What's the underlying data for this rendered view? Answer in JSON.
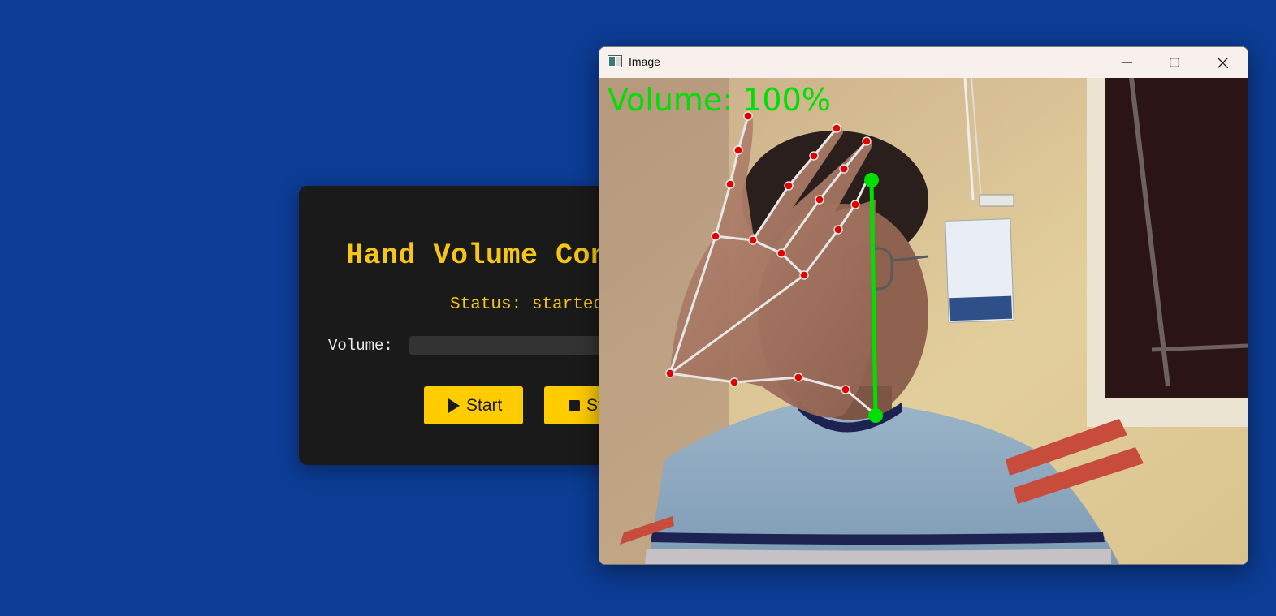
{
  "app": {
    "title": "Hand Volume Control",
    "status": "Status: started",
    "volume_label": "Volume:",
    "start_label": "Start",
    "stop_label": "Stop"
  },
  "window": {
    "title": "Image",
    "overlay_text": "Volume: 100%"
  },
  "colors": {
    "desktop_bg": "#0c3c94",
    "accent": "#ffcc00",
    "title_color": "#f5c518",
    "landmark": "#e00000",
    "pinch_line": "#00e000"
  },
  "icons": [
    "play-icon",
    "stop-icon",
    "app-icon",
    "minimize-icon",
    "maximize-icon",
    "close-icon"
  ]
}
